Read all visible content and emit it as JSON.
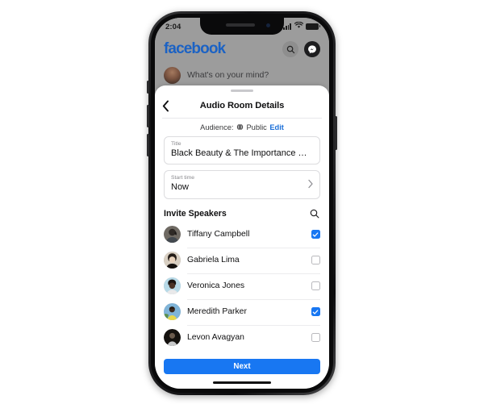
{
  "status_bar": {
    "time": "2:04",
    "signal_icon": "cellular-signal-icon",
    "wifi_icon": "wifi-icon",
    "battery_icon": "battery-icon"
  },
  "background_app": {
    "logo_text": "facebook",
    "search_icon": "search-icon",
    "messenger_icon": "messenger-icon",
    "composer_placeholder": "What's on your mind?"
  },
  "modal": {
    "title": "Audio Room Details",
    "back_icon": "chevron-left-icon",
    "audience": {
      "label": "Audience:",
      "globe_icon": "globe-icon",
      "value": "Public",
      "edit_label": "Edit"
    },
    "fields": [
      {
        "name": "title",
        "label": "Title",
        "value": "Black Beauty & The Importance of Self-..."
      },
      {
        "name": "start-time",
        "label": "Start time",
        "value": "Now",
        "chevron_icon": "chevron-right-icon"
      }
    ],
    "invite_speakers": {
      "title": "Invite Speakers",
      "search_icon": "search-icon",
      "speakers": [
        {
          "name": "Tiffany Campbell",
          "checked": true
        },
        {
          "name": "Gabriela Lima",
          "checked": false
        },
        {
          "name": "Veronica Jones",
          "checked": false
        },
        {
          "name": "Meredith Parker",
          "checked": true
        },
        {
          "name": "Levon Avagyan",
          "checked": false
        }
      ]
    },
    "next_label": "Next"
  },
  "colors": {
    "facebook_blue": "#1877f2",
    "link_blue": "#1a6ed8",
    "logo_blue": "#1b62c4"
  }
}
